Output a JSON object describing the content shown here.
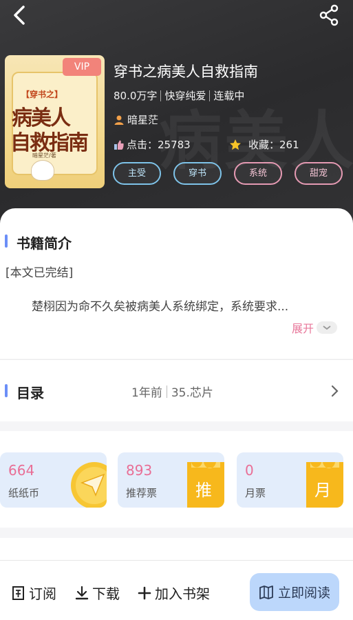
{
  "book": {
    "title": "穿书之病美人自救指南",
    "word_count": "80.0万字",
    "category": "快穿纯爱",
    "status": "连载中",
    "author": "暗星茫",
    "clicks_label": "点击：25783",
    "favorites_label": "收藏：261",
    "vip_badge": "VIP",
    "cover": {
      "tag_text": "【穿书之】",
      "title_line1": "病美人",
      "title_line2": "自救指南",
      "author_text": "暗星茫/著"
    },
    "tags": [
      "主受",
      "穿书",
      "系统",
      "甜宠"
    ]
  },
  "intro": {
    "section_title": "书籍简介",
    "completed_note": "[本文已完结]",
    "summary": "楚栩因为命不久矣被病美人系统绑定，系统要求...",
    "expand_label": "展开"
  },
  "toc": {
    "section_title": "目录",
    "updated": "1年前",
    "latest_chapter": "35.芯片"
  },
  "tickets": [
    {
      "value": "664",
      "label": "纸纸币",
      "icon": "paper-plane-coin-icon"
    },
    {
      "value": "893",
      "label": "推荐票",
      "icon": "recommend-ticket-icon",
      "glyph": "推"
    },
    {
      "value": "0",
      "label": "月票",
      "icon": "monthly-ticket-icon",
      "glyph": "月"
    }
  ],
  "actions": {
    "subscribe": "订阅",
    "download": "下载",
    "add_shelf": "加入书架",
    "read_now": "立即阅读"
  },
  "colors": {
    "accent_blue": "#6b8ef7",
    "accent_pink": "#e96e95",
    "read_button": "#bcd7fb"
  }
}
